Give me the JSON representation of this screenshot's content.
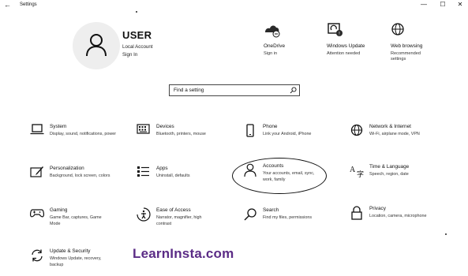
{
  "window": {
    "title": "Settings",
    "back_icon": "←",
    "minimize_icon": "—",
    "maximize_icon": "☐",
    "close_icon": "✕"
  },
  "profile": {
    "name": "USER",
    "account_type": "Local Account",
    "sign_in": "Sign In"
  },
  "quick_links": [
    {
      "title": "OneDrive",
      "subtitle": "Sign in",
      "icon": "onedrive-icon"
    },
    {
      "title": "Windows Update",
      "subtitle": "Attention needed",
      "icon": "windows-update-icon"
    },
    {
      "title": "Web browsing",
      "subtitle": "Recommended",
      "subtitle2": "settings",
      "icon": "globe-icon"
    }
  ],
  "search": {
    "placeholder": "Find a setting",
    "icon": "search-icon"
  },
  "categories": [
    {
      "title": "System",
      "desc": "Display, sound, notifications, power",
      "icon": "laptop-icon"
    },
    {
      "title": "Devices",
      "desc": "Bluetooth, printers, mouse",
      "icon": "keyboard-icon"
    },
    {
      "title": "Phone",
      "desc": "Link your Android, iPhone",
      "icon": "phone-icon"
    },
    {
      "title": "Network & Internet",
      "desc": "Wi-Fi, airplane mode, VPN",
      "icon": "globe-icon"
    },
    {
      "title": "Personalization",
      "desc": "Background, lock screen, colors",
      "icon": "paint-icon"
    },
    {
      "title": "Apps",
      "desc": "Uninstall, defaults",
      "icon": "apps-list-icon"
    },
    {
      "title": "Accounts",
      "desc": "Your accounts, email, sync, work, family",
      "icon": "person-icon"
    },
    {
      "title": "Time & Language",
      "desc": "Speech, region, date",
      "icon": "time-language-icon"
    },
    {
      "title": "Gaming",
      "desc": "Game Bar, captures, Game Mode",
      "icon": "gamepad-icon"
    },
    {
      "title": "Ease of Access",
      "desc": "Narrator, magnifier, high contrast",
      "icon": "ease-of-access-icon"
    },
    {
      "title": "Search",
      "desc": "Find my files, permissions",
      "icon": "search-icon"
    },
    {
      "title": "Privacy",
      "desc": "Location, camera, microphone",
      "icon": "lock-icon"
    },
    {
      "title": "Update & Security",
      "desc": "Windows Update, recovery, backup",
      "icon": "update-icon"
    }
  ],
  "watermark": "LearnInsta.com",
  "colors": {
    "background": "#ffffff",
    "accent": "#000000",
    "watermark": "#5b2c86",
    "onedrive_badge": "#2a2a2a"
  }
}
